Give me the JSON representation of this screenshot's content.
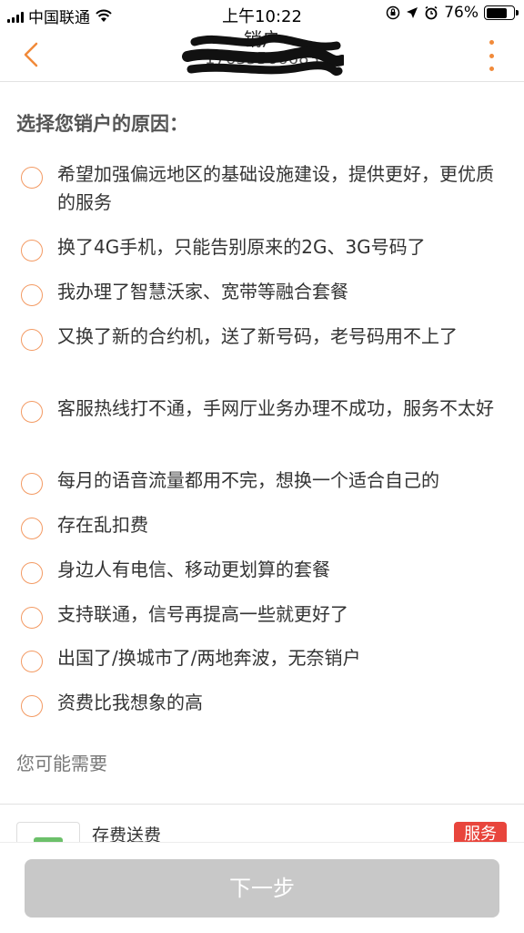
{
  "status_bar": {
    "carrier": "中国联通",
    "time": "上午10:22",
    "battery": "76%",
    "battery_level": 0.76
  },
  "header": {
    "title": "销户",
    "subtitle": "17635566683"
  },
  "section_title": "选择您销户的原因：",
  "reasons": [
    "希望加强偏远地区的基础设施建设，提供更好，更优质的服务",
    "换了4G手机，只能告别原来的2G、3G号码了",
    "我办理了智慧沃家、宽带等融合套餐",
    "又换了新的合约机，送了新号码，老号码用不上了",
    "客服热线打不通，手网厅业务办理不成功，服务不太好",
    "每月的语音流量都用不完，想换一个适合自己的",
    "存在乱扣费",
    "身边人有电信、移动更划算的套餐",
    "支持联通，信号再提高一些就更好了",
    "出国了/换城市了/两地奔波，无奈销户",
    "资费比我想象的高"
  ],
  "maybe_need": "您可能需要",
  "promo": {
    "title": "存费送费",
    "tag": "服务"
  },
  "next_button": "下一步",
  "colors": {
    "accent": "#f18a3a",
    "radio_border": "#f39a63",
    "tag_red": "#e8453c",
    "button_disabled": "#c8c8c8"
  }
}
